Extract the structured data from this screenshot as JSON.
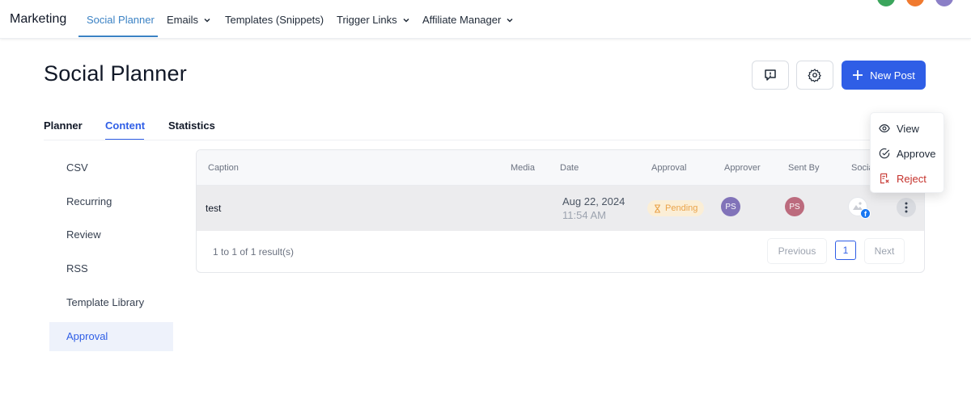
{
  "topnav": {
    "brand": "Marketing",
    "items": [
      {
        "label": "Social Planner"
      },
      {
        "label": "Emails"
      },
      {
        "label": "Templates (Snippets)"
      },
      {
        "label": "Trigger Links"
      },
      {
        "label": "Affiliate Manager"
      }
    ]
  },
  "header": {
    "title": "Social Planner",
    "new_post_label": "New Post"
  },
  "tabs": [
    {
      "label": "Planner"
    },
    {
      "label": "Content"
    },
    {
      "label": "Statistics"
    }
  ],
  "sidebar": {
    "items": [
      {
        "label": "CSV"
      },
      {
        "label": "Recurring"
      },
      {
        "label": "Review"
      },
      {
        "label": "RSS"
      },
      {
        "label": "Template Library"
      },
      {
        "label": "Approval"
      }
    ]
  },
  "table": {
    "columns": [
      "Caption",
      "Media",
      "Date",
      "Approval",
      "Approver",
      "Sent By",
      "Social"
    ],
    "rows": [
      {
        "caption": "test",
        "date": "Aug 22, 2024",
        "time": "11:54 AM",
        "approval": "Pending",
        "approver_initials": "PS",
        "sent_by_initials": "PS"
      }
    ],
    "results_text": "1 to 1 of 1 result(s)",
    "pagination": {
      "previous": "Previous",
      "page": "1",
      "next": "Next"
    }
  },
  "menu": {
    "items": [
      {
        "label": "View"
      },
      {
        "label": "Approve"
      },
      {
        "label": "Reject"
      }
    ]
  },
  "colors": {
    "accent": "#2f5ee6",
    "nav_active": "#3b82c4",
    "pending_bg": "#fbeed6",
    "pending_text": "#eaa34a",
    "approver_avatar": "#6f5fb0",
    "sent_by_avatar": "#b4556a",
    "danger": "#c5312b"
  }
}
